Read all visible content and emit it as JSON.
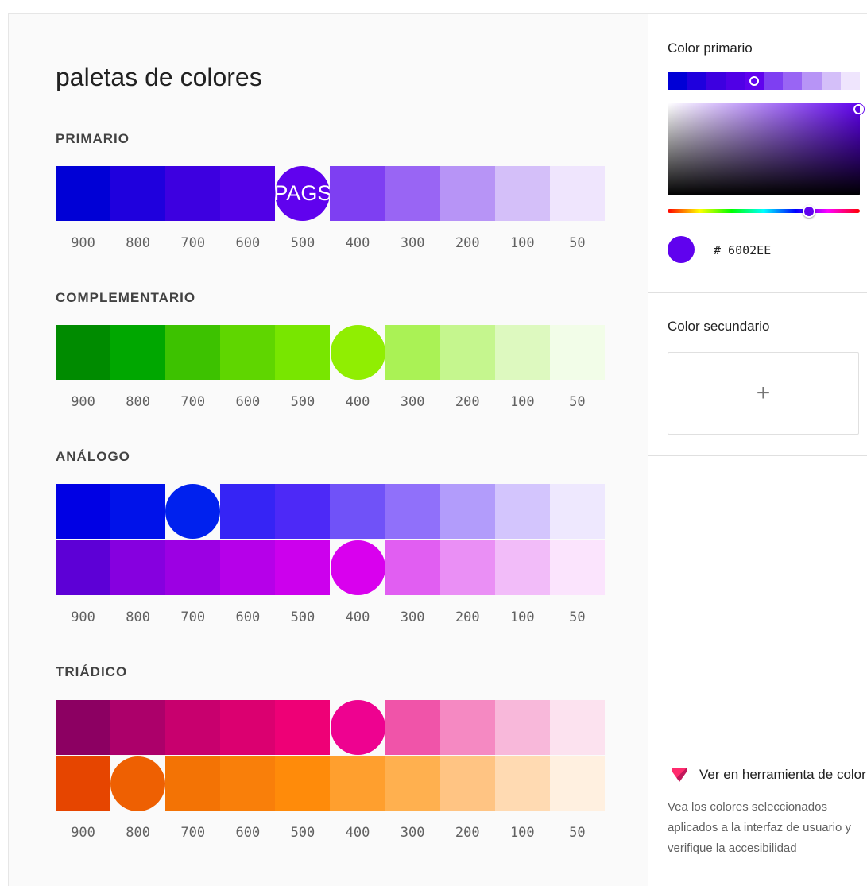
{
  "page": {
    "title": "paletas de colores"
  },
  "shades": [
    "900",
    "800",
    "700",
    "600",
    "500",
    "400",
    "300",
    "200",
    "100",
    "50"
  ],
  "palettes": [
    {
      "label": "PRIMARIO",
      "rows": [
        {
          "colors": [
            "#0000d6",
            "#1f00dd",
            "#3d00e0",
            "#5000e6",
            "#6002ee",
            "#7e3ff2",
            "#9965f4",
            "#b794f6",
            "#d4bff9",
            "#efe5fd"
          ],
          "selected": 4,
          "selected_text": "PAGS"
        }
      ]
    },
    {
      "label": "COMPLEMENTARIO",
      "rows": [
        {
          "colors": [
            "#008b00",
            "#00a700",
            "#3dc200",
            "#5fd600",
            "#78e600",
            "#90ee02",
            "#aaf255",
            "#c5f68e",
            "#ddf9bf",
            "#f2fde8"
          ],
          "selected": 5,
          "selected_text": ""
        }
      ]
    },
    {
      "label": "ANÁLOGO",
      "rows": [
        {
          "colors": [
            "#0000e4",
            "#0012ea",
            "#0021ee",
            "#3624f5",
            "#4d29f7",
            "#7052f8",
            "#9070fa",
            "#b29cfb",
            "#d3c5fd",
            "#eee8fe"
          ],
          "selected": 2,
          "selected_text": ""
        },
        {
          "colors": [
            "#5d00d6",
            "#8600df",
            "#9c00e3",
            "#b600e9",
            "#cc00ed",
            "#d900ee",
            "#e15ef2",
            "#ea8ff5",
            "#f2bcf9",
            "#fbe4fd"
          ],
          "selected": 5,
          "selected_text": ""
        }
      ]
    },
    {
      "label": "TRIÁDICO",
      "rows": [
        {
          "colors": [
            "#8c0062",
            "#ac006a",
            "#c8006e",
            "#db0070",
            "#ee0076",
            "#ee0290",
            "#f054a9",
            "#f589c2",
            "#f8b8da",
            "#fce2ef"
          ],
          "selected": 5,
          "selected_text": ""
        },
        {
          "colors": [
            "#e64500",
            "#ee6002",
            "#f37305",
            "#f97f0a",
            "#ff8b0a",
            "#ff9f2e",
            "#ffb04f",
            "#ffc483",
            "#ffdab2",
            "#fff0e0"
          ],
          "selected": 1,
          "selected_text": ""
        }
      ]
    }
  ],
  "sidebar": {
    "primary": {
      "title": "Color primario",
      "mini_strip": [
        "#0000d6",
        "#1f00dd",
        "#3d00e0",
        "#5000e6",
        "#6002ee",
        "#7e3ff2",
        "#9965f4",
        "#b794f6",
        "#d4bff9",
        "#efe5fd"
      ],
      "mini_selected": 4,
      "hex_value": "# 6002EE",
      "color": "#6002ee"
    },
    "secondary": {
      "title": "Color secundario",
      "add_label": "+"
    },
    "tool": {
      "link_text": "Ver en herramienta de color",
      "description": "Vea los colores seleccionados aplicados a la interfaz de usuario y verifique la accesibilidad"
    }
  }
}
